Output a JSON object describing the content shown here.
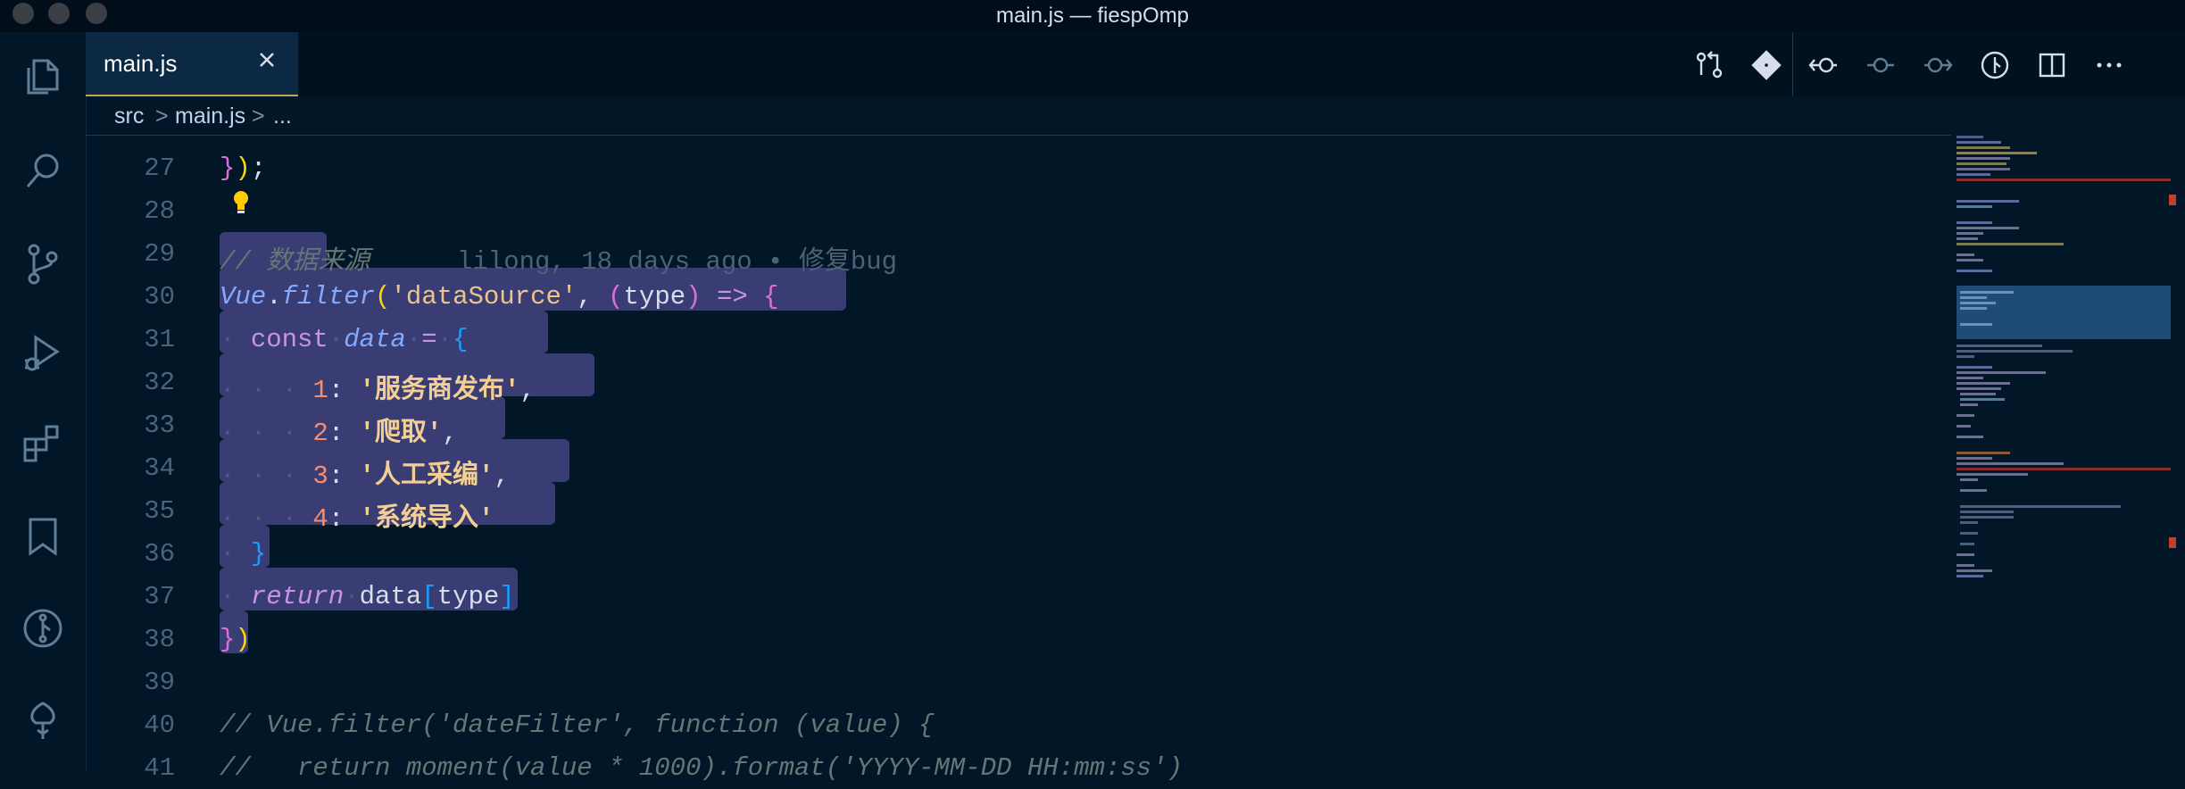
{
  "window": {
    "title": "main.js — fiespOmp"
  },
  "activity_bar": {
    "items": [
      "explorer-icon",
      "search-icon",
      "source-control-icon",
      "run-debug-icon",
      "extensions-icon",
      "bookmarks-icon",
      "gitlens-icon",
      "tree-icon"
    ]
  },
  "tab": {
    "label": "main.js",
    "close": "×"
  },
  "editor_actions": [
    "open-changes-icon",
    "git-commit-icon",
    "previous-revision-icon",
    "commit-node-icon",
    "next-revision-icon",
    "blame-icon",
    "split-editor-icon",
    "more-actions-icon"
  ],
  "breadcrumb": {
    "items": [
      "src",
      "main.js",
      "..."
    ],
    "separator": ">"
  },
  "blame": "lilong, 18 days ago • 修复bug",
  "lines": [
    {
      "n": "27"
    },
    {
      "n": "28"
    },
    {
      "n": "29",
      "comment": "// 数据来源"
    },
    {
      "n": "30",
      "obj": "Vue",
      "fn": "filter",
      "str": "'dataSource'",
      "param": "type"
    },
    {
      "n": "31",
      "kw": "const",
      "name": "data"
    },
    {
      "n": "32",
      "key": "1",
      "val": "'服务商发布'"
    },
    {
      "n": "33",
      "key": "2",
      "val": "'爬取'"
    },
    {
      "n": "34",
      "key": "3",
      "val": "'人工采编'"
    },
    {
      "n": "35",
      "key": "4",
      "val": "'系统导入'"
    },
    {
      "n": "36"
    },
    {
      "n": "37",
      "kw": "return",
      "obj": "data",
      "prop": "type"
    },
    {
      "n": "38"
    },
    {
      "n": "39"
    },
    {
      "n": "40",
      "comment": "// Vue.filter('dateFilter', function (value) {"
    },
    {
      "n": "41",
      "comment": "//   return moment(value * 1000).format('YYYY-MM-DD HH:mm:ss')"
    }
  ],
  "colors": {
    "background": "#011627",
    "selection": "#3a3d74",
    "tab_accent": "#c8a35a",
    "string": "#ecc48d",
    "number": "#f78c6c",
    "keyword": "#c792ea"
  }
}
